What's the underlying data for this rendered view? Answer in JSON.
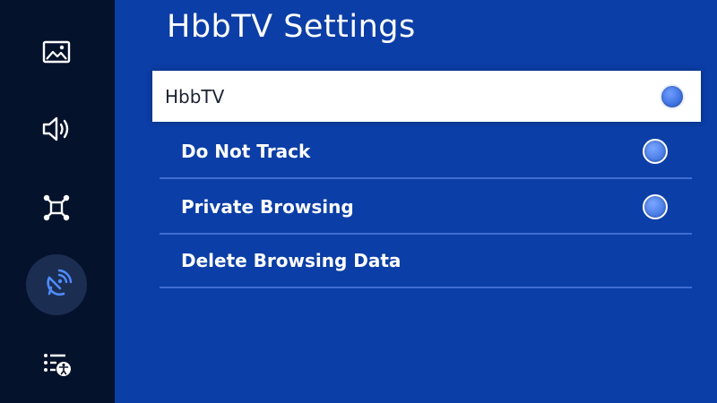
{
  "page": {
    "title": "HbbTV Settings"
  },
  "sidebar": {
    "items": [
      {
        "name": "picture-icon"
      },
      {
        "name": "sound-icon"
      },
      {
        "name": "network-icon"
      },
      {
        "name": "broadcast-icon",
        "active": true
      },
      {
        "name": "accessibility-icon"
      }
    ]
  },
  "menu": {
    "items": [
      {
        "label": "HbbTV",
        "toggle": true,
        "focused": true
      },
      {
        "label": "Do Not Track",
        "toggle": true
      },
      {
        "label": "Private Browsing",
        "toggle": true
      },
      {
        "label": "Delete Browsing Data",
        "toggle": false
      }
    ]
  },
  "colors": {
    "background": "#0b3ea6",
    "sidebar": "#05122c",
    "focus": "#ffffff"
  }
}
